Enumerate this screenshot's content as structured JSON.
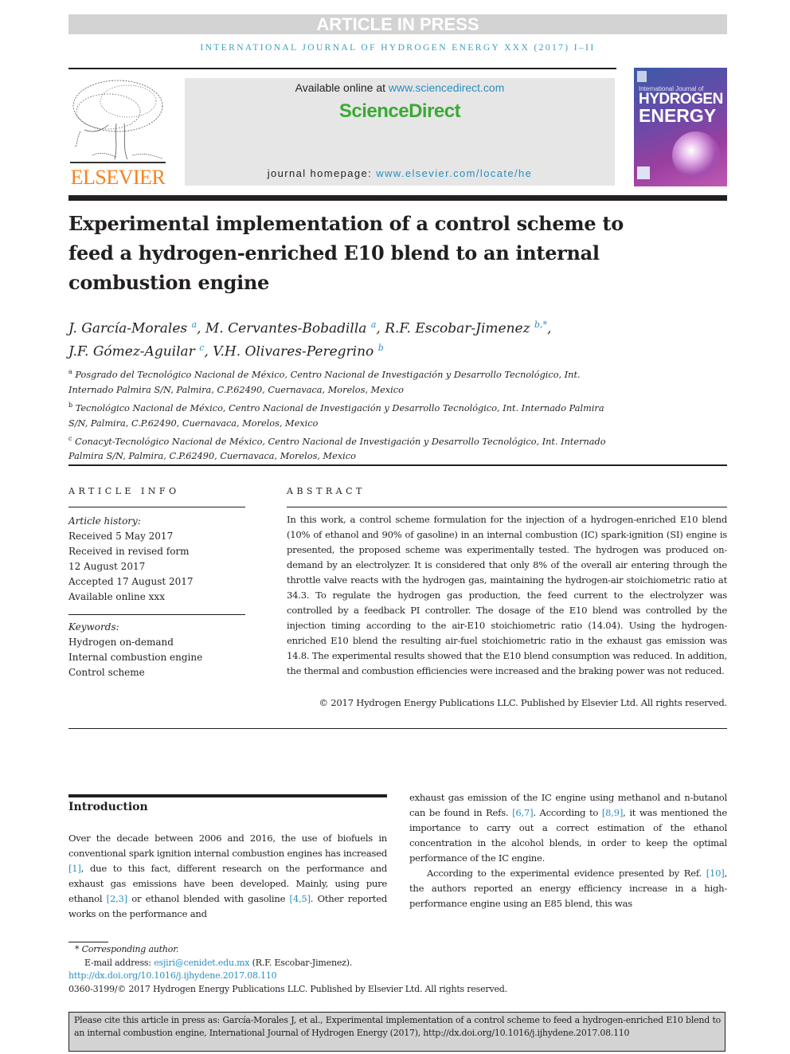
{
  "banner": {
    "text": "ARTICLE IN PRESS"
  },
  "journal_header": {
    "text": "INTERNATIONAL JOURNAL OF HYDROGEN ENERGY XXX (2017) I–II"
  },
  "publisher": {
    "logo_word": "ELSEVIER",
    "logo_icon": "elsevier-tree-icon",
    "color": "#f58220"
  },
  "sciencedirect": {
    "available_prefix": "Available online at ",
    "available_link": "www.sciencedirect.com",
    "brand": "ScienceDirect",
    "brand_color": "#3aaa35",
    "homepage_prefix": "journal homepage: ",
    "homepage_link": "www.elsevier.com/locate/he"
  },
  "cover": {
    "line1": "International Journal of",
    "line2": "HYDROGEN",
    "line3": "ENERGY"
  },
  "article": {
    "title": "Experimental implementation of a control scheme to feed a hydrogen-enriched E10 blend to an internal combustion engine",
    "authors": [
      {
        "name": "J. García-Morales",
        "aff": "a"
      },
      {
        "name": "M. Cervantes-Bobadilla",
        "aff": "a"
      },
      {
        "name": "R.F. Escobar-Jimenez",
        "aff": "b,*"
      },
      {
        "name": "J.F. Gómez-Aguilar",
        "aff": "c"
      },
      {
        "name": "V.H. Olivares-Peregrino",
        "aff": "b"
      }
    ],
    "affiliations": [
      {
        "key": "a",
        "text": "Posgrado del Tecnológico Nacional de México, Centro Nacional de Investigación y Desarrollo Tecnológico, Int. Internado Palmira S/N, Palmira, C.P.62490, Cuernavaca, Morelos, Mexico"
      },
      {
        "key": "b",
        "text": "Tecnológico Nacional de México, Centro Nacional de Investigación y Desarrollo Tecnológico, Int. Internado Palmira S/N, Palmira, C.P.62490, Cuernavaca, Morelos, Mexico"
      },
      {
        "key": "c",
        "text": "Conacyt-Tecnológico Nacional de México, Centro Nacional de Investigación y Desarrollo Tecnológico, Int. Internado Palmira S/N, Palmira, C.P.62490, Cuernavaca, Morelos, Mexico"
      }
    ]
  },
  "article_info": {
    "heading": "ARTICLE INFO",
    "history_label": "Article history:",
    "history": [
      "Received 5 May 2017",
      "Received in revised form",
      "12 August 2017",
      "Accepted 17 August 2017",
      "Available online xxx"
    ],
    "keywords_label": "Keywords:",
    "keywords": [
      "Hydrogen on-demand",
      "Internal combustion engine",
      "Control scheme"
    ]
  },
  "abstract": {
    "heading": "ABSTRACT",
    "text": "In this work, a control scheme formulation for the injection of a hydrogen-enriched E10 blend (10% of ethanol and 90% of gasoline) in an internal combustion (IC) spark-ignition (SI) engine is presented, the proposed scheme was experimentally tested. The hydrogen was produced on-demand by an electrolyzer. It is considered that only 8% of the overall air entering through the throttle valve reacts with the hydrogen gas, maintaining the hydrogen-air stoichiometric ratio at 34.3. To regulate the hydrogen gas production, the feed current to the electrolyzer was controlled by a feedback PI controller. The dosage of the E10 blend was controlled by the injection timing according to the air-E10 stoichiometric ratio (14.04). Using the hydrogen-enriched E10 blend the resulting air-fuel stoichiometric ratio in the exhaust gas emission was 14.8. The experimental results showed that the E10 blend consumption was reduced. In addition, the thermal and combustion efficiencies were increased and the braking power was not reduced.",
    "copyright": "© 2017 Hydrogen Energy Publications LLC. Published by Elsevier Ltd. All rights reserved."
  },
  "introduction": {
    "heading": "Introduction",
    "left": {
      "t1": "Over the decade between 2006 and 2016, the use of biofuels in conventional spark ignition internal combustion engines has increased ",
      "r1": "[1]",
      "t2": ", due to this fact, different research on the performance and exhaust gas emissions have been developed. Mainly, using pure ethanol ",
      "r2": "[2,3]",
      "t3": " or ethanol blended with gasoline ",
      "r3": "[4,5]",
      "t4": ". Other reported works on the performance and"
    },
    "right": {
      "t1": "exhaust gas emission of the IC engine using methanol and n-butanol can be found in Refs. ",
      "r1": "[6,7]",
      "t2": ". According to ",
      "r2": "[8,9]",
      "t3": ", it was mentioned the importance to carry out a correct estimation of the ethanol concentration in the alcohol blends, in order to keep the optimal performance of the IC engine.",
      "p2_t1": "According to the experimental evidence presented by Ref. ",
      "p2_r1": "[10]",
      "p2_t2": ", the authors reported an energy efficiency increase in a high-performance engine using an E85 blend, this was"
    }
  },
  "footnotes": {
    "corresponding": "* Corresponding author.",
    "email_label": "E-mail address: ",
    "email": "esjiri@cenidet.edu.mx",
    "email_suffix": " (R.F. Escobar-Jimenez).",
    "doi": "http://dx.doi.org/10.1016/j.ijhydene.2017.08.110",
    "issn_copyright": "0360-3199/© 2017 Hydrogen Energy Publications LLC. Published by Elsevier Ltd. All rights reserved."
  },
  "citation": {
    "text": "Please cite this article in press as: García-Morales J, et al., Experimental implementation of a control scheme to feed a hydrogen-enriched E10 blend to an internal combustion engine, International Journal of Hydrogen Energy (2017), http://dx.doi.org/10.1016/j.ijhydene.2017.08.110"
  }
}
